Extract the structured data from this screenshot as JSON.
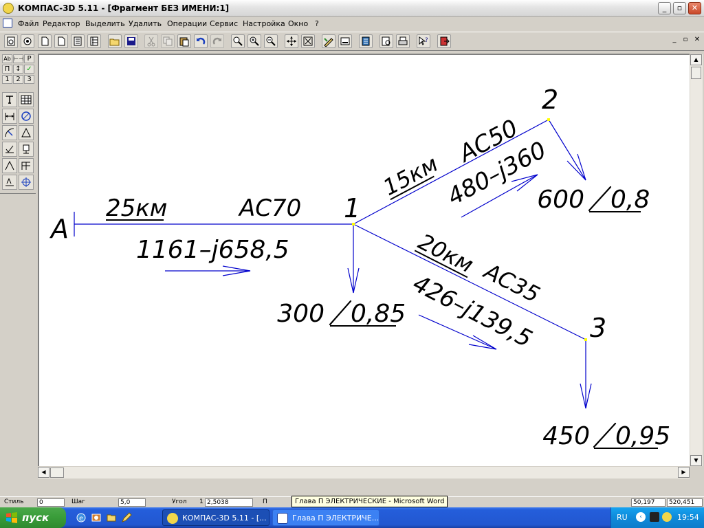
{
  "window": {
    "title": "КОМПАС-3D 5.11 - [Фрагмент БЕЗ ИМЕНИ:1]",
    "controls": {
      "minimize": "_",
      "maximize": "▫",
      "close": "✕"
    }
  },
  "menu": {
    "items": [
      "Файл",
      "Редактор",
      "Выделить",
      "Удалить",
      "Операции",
      "Сервис",
      "Настройка",
      "Окно",
      "?"
    ],
    "doc_controls": {
      "minimize": "_",
      "restore": "▫",
      "close": "✕"
    }
  },
  "toolbar": {
    "buttons": [
      "new-document",
      "open-model",
      "new-fragment",
      "new-sheet",
      "new-spec",
      "new-text",
      "open",
      "save",
      "cut",
      "copy",
      "paste",
      "undo",
      "redo",
      "zoom",
      "zoom-in",
      "zoom-out",
      "pan",
      "zoom-fit",
      "regenerate",
      "draw-mode",
      "calc-panel",
      "preview",
      "print",
      "context-help",
      "exit"
    ]
  },
  "palette": {
    "top_glyphs": [
      "Ab",
      "⊢⊣",
      "P",
      "П",
      "↕",
      "✓"
    ],
    "page_numbers": [
      "1",
      "2",
      "3"
    ],
    "tools": [
      "text-tool",
      "table-tool",
      "dimension-tool",
      "circle-tool",
      "arc-tool",
      "triangle-tool",
      "check-tool",
      "symbol-tool",
      "angle-tool",
      "grid-tool",
      "baseline-tool",
      "crosshair-tool"
    ]
  },
  "drawing": {
    "source_node": "А",
    "nodes": {
      "n1": "1",
      "n2": "2",
      "n3": "3"
    },
    "line_A1": {
      "length": "25км",
      "wire": "АС70",
      "flow": "1161–j658,5"
    },
    "line_12": {
      "length": "15км",
      "wire": "АС50",
      "flow": "480–j360"
    },
    "line_13": {
      "length": "20км",
      "wire": "АС35",
      "flow": "426–j139,5"
    },
    "loads": {
      "n1": {
        "power": "300",
        "pf": "0,85"
      },
      "n2": {
        "power": "600",
        "pf": "0,8"
      },
      "n3": {
        "power": "450",
        "pf": "0,95"
      }
    },
    "colors": {
      "line": "#0000cc",
      "text": "#000000",
      "node": "#ffff00"
    }
  },
  "statusbar": {
    "tooltip": "Глава П ЭЛЕКТРИЧЕСКИЕ - Microsoft Word",
    "fields": [
      "Стиль",
      "0",
      "Шаг",
      "5,0",
      "Угол",
      "1",
      "2,5038",
      "П",
      "50,197",
      "520,451"
    ]
  },
  "taskbar": {
    "start_label": "пуск",
    "quicklaunch": [
      "ie-icon",
      "media-icon",
      "pencil-icon"
    ],
    "tasks": [
      "КОМПАС-3D 5.11 - [...",
      "Глава П ЭЛЕКТРИЧЕ..."
    ],
    "lang": "RU",
    "clock": "19:54"
  }
}
